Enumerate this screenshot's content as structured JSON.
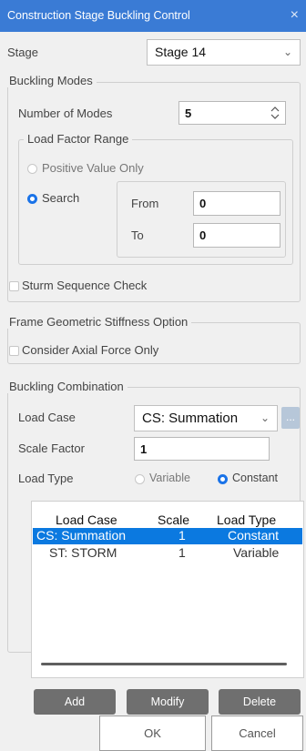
{
  "window": {
    "title": "Construction Stage Buckling Control",
    "close_glyph": "×"
  },
  "stage": {
    "label": "Stage",
    "value": "Stage 14"
  },
  "buckling_modes": {
    "title": "Buckling Modes",
    "number_of_modes_label": "Number of Modes",
    "number_of_modes_value": "5",
    "load_factor_range": {
      "title": "Load Factor Range",
      "positive_label": "Positive Value Only",
      "search_label": "Search",
      "selected": "Search",
      "from_label": "From",
      "from_value": "0",
      "to_label": "To",
      "to_value": "0"
    },
    "sturm_label": "Sturm Sequence Check",
    "sturm_checked": false
  },
  "frame_geometric": {
    "title": "Frame Geometric Stiffness Option",
    "consider_label": "Consider Axial Force Only",
    "consider_checked": false
  },
  "buckling_combination": {
    "title": "Buckling Combination",
    "load_case_label": "Load Case",
    "load_case_value": "CS: Summation",
    "browse_glyph": "...",
    "scale_factor_label": "Scale Factor",
    "scale_factor_value": "1",
    "load_type_label": "Load Type",
    "variable_label": "Variable",
    "constant_label": "Constant",
    "load_type_selected": "Constant",
    "table": {
      "headers": [
        "Load Case",
        "Scale",
        "Load Type"
      ],
      "rows": [
        {
          "load_case": "CS: Summation",
          "scale": "1",
          "load_type": "Constant",
          "selected": true
        },
        {
          "load_case": "ST: STORM",
          "scale": "1",
          "load_type": "Variable",
          "selected": false
        }
      ]
    },
    "add_label": "Add",
    "modify_label": "Modify",
    "delete_label": "Delete"
  },
  "footer": {
    "ok_label": "OK",
    "cancel_label": "Cancel"
  },
  "colors": {
    "titlebar": "#3a7bd5",
    "accent": "#1a73e8",
    "selection": "#0b79e0",
    "button_dark": "#6f6f6f"
  }
}
